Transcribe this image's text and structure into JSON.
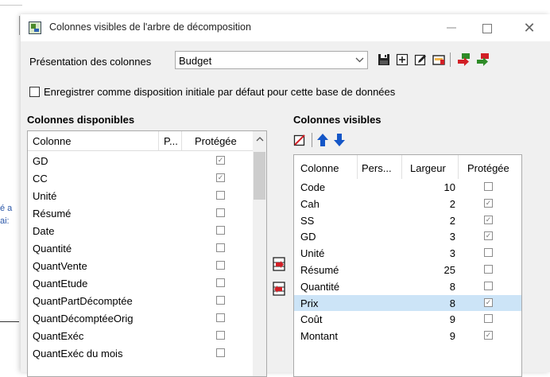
{
  "background": {
    "edge_text": [
      "é a",
      "ai:"
    ]
  },
  "dialog": {
    "title": "Colonnes visibles de l'arbre de décomposition",
    "close_glyph": "✕"
  },
  "presentation": {
    "label": "Présentation des colonnes",
    "value": "Budget"
  },
  "default_layout_checkbox": {
    "label": "Enregistrer comme disposition initiale par défaut pour cette base de données",
    "checked": false
  },
  "available": {
    "title": "Colonnes disponibles",
    "headers": [
      "Colonne",
      "P...",
      "Protégée"
    ],
    "rows": [
      {
        "name": "GD",
        "protected": true
      },
      {
        "name": "CC",
        "protected": true
      },
      {
        "name": "Unité",
        "protected": false
      },
      {
        "name": "Résumé",
        "protected": false
      },
      {
        "name": "Date",
        "protected": false
      },
      {
        "name": "Quantité",
        "protected": false
      },
      {
        "name": "QuantVente",
        "protected": false
      },
      {
        "name": "QuantEtude",
        "protected": false
      },
      {
        "name": "QuantPartDécomptée",
        "protected": false
      },
      {
        "name": "QuantDécomptéeOrig",
        "protected": false
      },
      {
        "name": "QuantExéc",
        "protected": false
      },
      {
        "name": "QuantExéc du mois",
        "protected": false
      }
    ]
  },
  "visible": {
    "title": "Colonnes visibles",
    "headers": [
      "Colonne",
      "Pers...",
      "Largeur",
      "Protégée"
    ],
    "selected_row": "Prix",
    "rows": [
      {
        "name": "Code",
        "width": "10",
        "protected": false
      },
      {
        "name": "Cah",
        "width": "2",
        "protected": true
      },
      {
        "name": "SS",
        "width": "2",
        "protected": true
      },
      {
        "name": "GD",
        "width": "3",
        "protected": true
      },
      {
        "name": "Unité",
        "width": "3",
        "protected": false
      },
      {
        "name": "Résumé",
        "width": "25",
        "protected": false
      },
      {
        "name": "Quantité",
        "width": "8",
        "protected": false
      },
      {
        "name": "Prix",
        "width": "8",
        "protected": true
      },
      {
        "name": "Coût",
        "width": "9",
        "protected": false
      },
      {
        "name": "Montant",
        "width": "9",
        "protected": true
      }
    ]
  },
  "icons": {
    "help": "?",
    "toolbar": [
      "save-icon",
      "add-icon",
      "edit-icon",
      "clear-icon",
      "export-icon",
      "import-icon"
    ],
    "right_toolbar": [
      "clear-selection-icon",
      "move-up-icon",
      "move-down-icon"
    ],
    "transfer": [
      "move-right-icon",
      "move-left-icon"
    ]
  },
  "colors": {
    "selection": "#cce4f7",
    "arrow_blue": "#1456c7",
    "accent_red": "#d21f26",
    "accent_green": "#2e8b27"
  }
}
